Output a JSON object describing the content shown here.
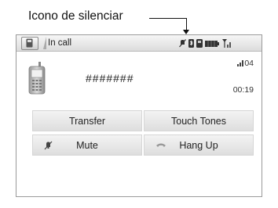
{
  "callout": {
    "label": "Icono de silenciar"
  },
  "header": {
    "title": "In call",
    "status_icons": [
      "mute-icon",
      "bluetooth-icon",
      "phone-status-icon",
      "battery-icon",
      "signal-icon"
    ]
  },
  "call": {
    "count": "04",
    "number": "#######",
    "timer": "00:19"
  },
  "buttons": {
    "transfer": "Transfer",
    "touch_tones": "Touch Tones",
    "mute": "Mute",
    "hang_up": "Hang Up"
  },
  "colors": {
    "button_top": "#f3f3f3",
    "button_bottom": "#dedede",
    "header_bar": "#e8e8e8",
    "frame_border": "#9a9a9a"
  }
}
